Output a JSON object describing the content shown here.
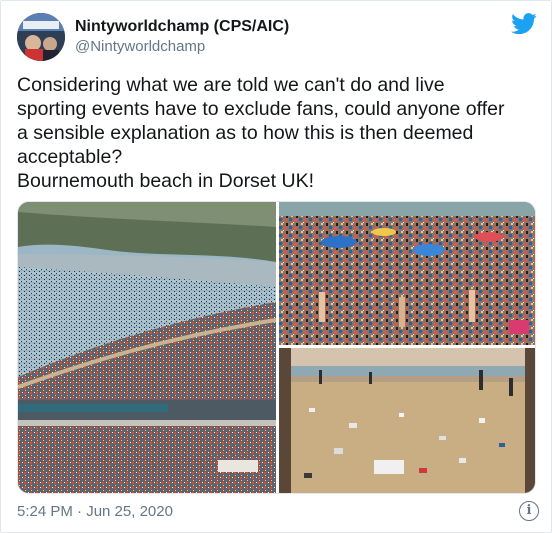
{
  "tweet": {
    "author_name": "Nintyworldchamp (CPS/AIC)",
    "author_handle": "@Nintyworldchamp",
    "text_lines": [
      "Considering what we are told we can't do and live",
      "sporting events have to exclude fans, could anyone offer",
      "a sensible explanation as to how this is then deemed",
      "acceptable?",
      "Bournemouth beach in Dorset UK!"
    ],
    "timestamp": "5:24 PM · Jun 25, 2020",
    "info_glyph": "i"
  },
  "icons": {
    "brand": "twitter-bird-icon",
    "info": "info-icon"
  },
  "media": [
    {
      "name": "crowded-beach-aerial-photo"
    },
    {
      "name": "crowded-beach-closeup-photo"
    },
    {
      "name": "littered-beach-photo"
    }
  ],
  "colors": {
    "brand_blue": "#1da1f2",
    "secondary_text": "#657786",
    "primary_text": "#14171a",
    "border": "#e1e8ed"
  }
}
